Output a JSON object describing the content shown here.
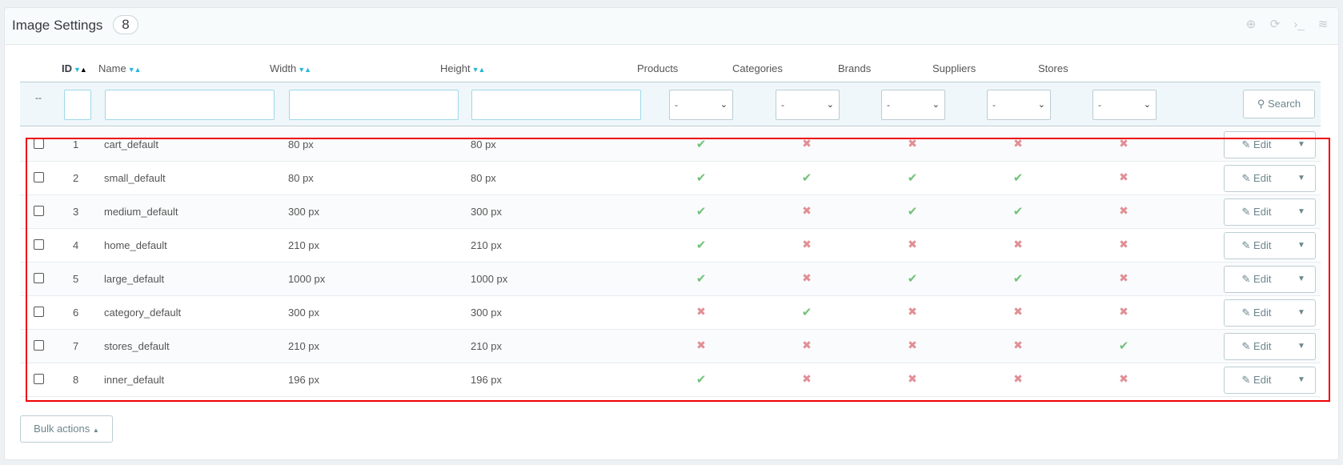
{
  "panel": {
    "title": "Image Settings",
    "count": "8"
  },
  "toolbar": {
    "icons": [
      "add-icon",
      "refresh-icon",
      "sql-query-icon",
      "database-icon"
    ]
  },
  "columns": {
    "id": "ID",
    "name": "Name",
    "width": "Width",
    "height": "Height",
    "products": "Products",
    "categories": "Categories",
    "brands": "Brands",
    "suppliers": "Suppliers",
    "stores": "Stores"
  },
  "filters": {
    "dash": "--",
    "select_value": "-",
    "search_label": "Search"
  },
  "rows": [
    {
      "id": "1",
      "name": "cart_default",
      "width": "80 px",
      "height": "80 px",
      "products": true,
      "categories": false,
      "brands": false,
      "suppliers": false,
      "stores": false
    },
    {
      "id": "2",
      "name": "small_default",
      "width": "80 px",
      "height": "80 px",
      "products": true,
      "categories": true,
      "brands": true,
      "suppliers": true,
      "stores": false
    },
    {
      "id": "3",
      "name": "medium_default",
      "width": "300 px",
      "height": "300 px",
      "products": true,
      "categories": false,
      "brands": true,
      "suppliers": true,
      "stores": false
    },
    {
      "id": "4",
      "name": "home_default",
      "width": "210 px",
      "height": "210 px",
      "products": true,
      "categories": false,
      "brands": false,
      "suppliers": false,
      "stores": false
    },
    {
      "id": "5",
      "name": "large_default",
      "width": "1000 px",
      "height": "1000 px",
      "products": true,
      "categories": false,
      "brands": true,
      "suppliers": true,
      "stores": false
    },
    {
      "id": "6",
      "name": "category_default",
      "width": "300 px",
      "height": "300 px",
      "products": false,
      "categories": true,
      "brands": false,
      "suppliers": false,
      "stores": false
    },
    {
      "id": "7",
      "name": "stores_default",
      "width": "210 px",
      "height": "210 px",
      "products": false,
      "categories": false,
      "brands": false,
      "suppliers": false,
      "stores": true
    },
    {
      "id": "8",
      "name": "inner_default",
      "width": "196 px",
      "height": "196 px",
      "products": true,
      "categories": false,
      "brands": false,
      "suppliers": false,
      "stores": false
    }
  ],
  "row_actions": {
    "edit_label": "Edit"
  },
  "footer": {
    "bulk_actions_label": "Bulk actions"
  },
  "colors": {
    "accent": "#25b9d7",
    "yes": "#72c279",
    "no": "#e08f95",
    "highlight": "#ee0000"
  }
}
